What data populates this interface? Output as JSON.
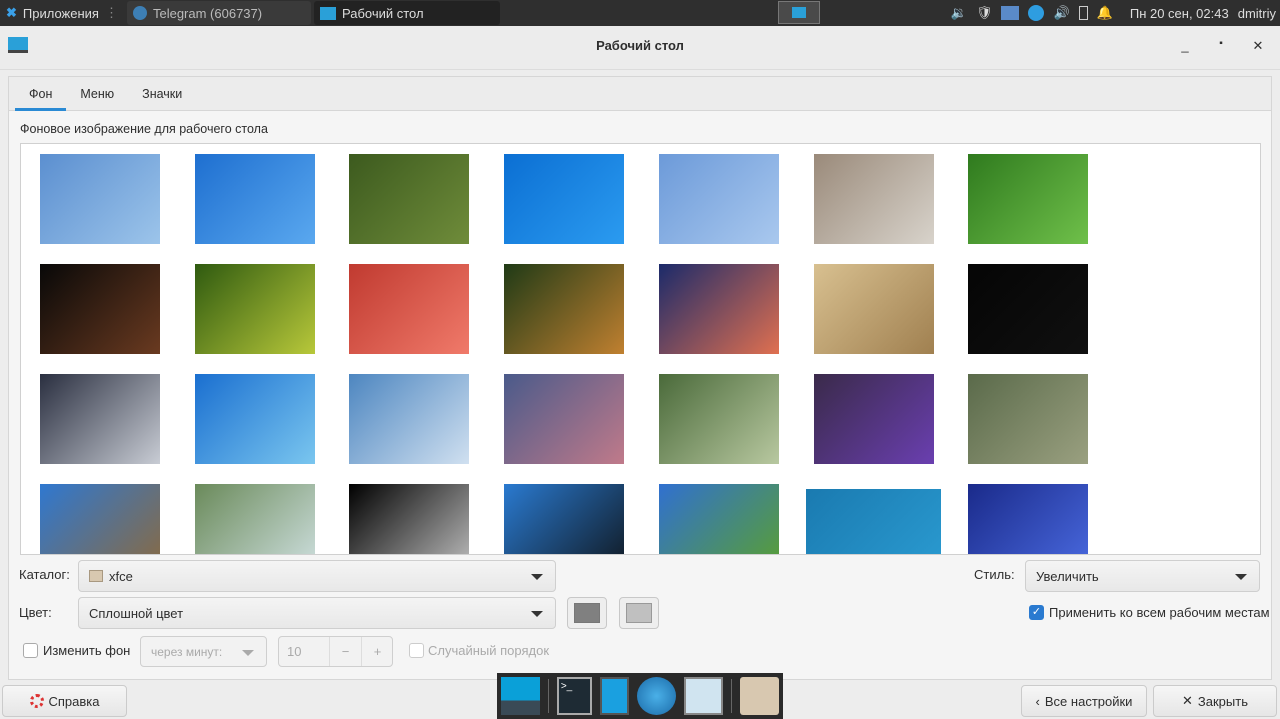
{
  "panel": {
    "apps": "Приложения",
    "tasks": [
      {
        "label": "Telegram (606737)"
      },
      {
        "label": "Рабочий стол"
      }
    ],
    "clock": "Пн 20 сен, 02:43",
    "user": "dmitriy"
  },
  "window": {
    "title": "Рабочий стол"
  },
  "tabs": [
    {
      "label": "Фон"
    },
    {
      "label": "Меню"
    },
    {
      "label": "Значки"
    }
  ],
  "background": {
    "section_label": "Фоновое изображение для рабочего стола",
    "thumbnails": [
      [
        "#5b8fd0",
        "#9cc4ea"
      ],
      [
        "#1e6fd0",
        "#5aa8ef"
      ],
      [
        "#3c5a1e",
        "#6f8c3a"
      ],
      [
        "#0b6fd3",
        "#2b9bf0"
      ],
      [
        "#6c9ad9",
        "#a9c8ee"
      ],
      [
        "#9a8a7a",
        "#d8d3cb"
      ],
      [
        "#2f7a1e",
        "#6fc04a"
      ],
      [
        "#080808",
        "#6a3a20"
      ],
      [
        "#2f5a10",
        "#b8c83a"
      ],
      [
        "#c03a30",
        "#f07a6a"
      ],
      [
        "#1f3a16",
        "#c08030"
      ],
      [
        "#1b2a6a",
        "#e07050"
      ],
      [
        "#d8c090",
        "#a08050"
      ],
      [
        "#050505",
        "#101010"
      ],
      [
        "#2a2f40",
        "#c8ccd4"
      ],
      [
        "#1a6fd0",
        "#7ac6ef"
      ],
      [
        "#4d86c0",
        "#d0e0f0"
      ],
      [
        "#4a5a8a",
        "#c07a8a"
      ],
      [
        "#4a6a3a",
        "#b8c8a0"
      ],
      [
        "#3a2a4a",
        "#6a3fb0"
      ],
      [
        "#5a6a4a",
        "#9aa080"
      ],
      [
        "#2f78d0",
        "#8a6a40"
      ],
      [
        "#6a8a5a",
        "#cfe0e0"
      ],
      [
        "#000000",
        "#c0c0c0"
      ],
      [
        "#2a7ad0",
        "#101820"
      ],
      [
        "#3070d0",
        "#5aa030"
      ],
      [
        "#1a7ab0",
        "#2a9ad0"
      ],
      [
        "#1a2a8a",
        "#4a6ae0"
      ]
    ]
  },
  "controls": {
    "catalog_label": "Каталог:",
    "catalog_value": "xfce",
    "style_label": "Стиль:",
    "style_value": "Увеличить",
    "color_label": "Цвет:",
    "color_value": "Сплошной цвет",
    "primary_color": "#808080",
    "secondary_color": "#c0c0c0",
    "apply_all_label": "Применить ко всем рабочим местам",
    "apply_all_checked": true,
    "change_bg_label": "Изменить фон",
    "interval_value": "через минут:",
    "minutes_value": "10",
    "random_label": "Случайный порядок"
  },
  "buttons": {
    "help": "Справка",
    "all_settings": "Все настройки",
    "close": "Закрыть"
  }
}
